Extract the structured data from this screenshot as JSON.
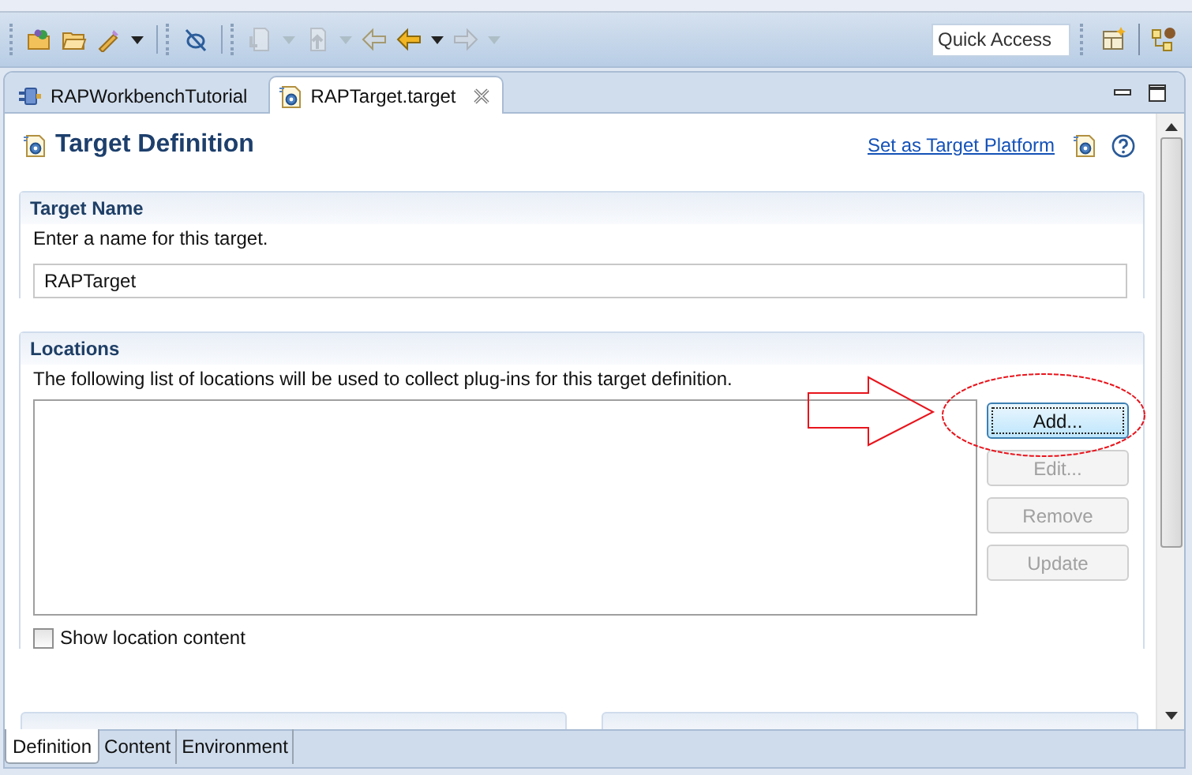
{
  "toolbar": {
    "items": [
      {
        "kind": "folder-plug",
        "disabled": false,
        "dropdown": false
      },
      {
        "kind": "folder",
        "disabled": false,
        "dropdown": false
      },
      {
        "kind": "wand",
        "disabled": false,
        "dropdown": true
      },
      {
        "kind": "separator"
      },
      {
        "kind": "link-off",
        "disabled": false,
        "dropdown": false
      },
      {
        "kind": "separator"
      },
      {
        "kind": "doc-down",
        "disabled": true,
        "dropdown": true
      },
      {
        "kind": "doc-up",
        "disabled": true,
        "dropdown": true
      },
      {
        "kind": "arrow-left",
        "disabled": true,
        "dropdown": false
      },
      {
        "kind": "arrow-left",
        "disabled": false,
        "dropdown": true
      },
      {
        "kind": "arrow-right",
        "disabled": true,
        "dropdown": true
      }
    ],
    "quick_access": {
      "placeholder": "Quick Access"
    }
  },
  "editor_tabs": [
    {
      "label": "RAPWorkbenchTutorial",
      "selected": false,
      "kind": "plugin"
    },
    {
      "label": "RAPTarget.target",
      "selected": true,
      "kind": "target"
    }
  ],
  "page": {
    "title": "Target Definition",
    "link": "Set as Target Platform"
  },
  "sections": [
    {
      "kind": "name",
      "title": "Target Name",
      "description": "Enter a name for this target.",
      "value": "RAPTarget"
    },
    {
      "kind": "locations",
      "title": "Locations",
      "description": "The following list of locations will be used to collect plug-ins for this target definition.",
      "buttons": [
        {
          "label": "Add...",
          "disabled": false,
          "focused": true
        },
        {
          "label": "Edit...",
          "disabled": true,
          "focused": false
        },
        {
          "label": "Remove",
          "disabled": true,
          "focused": false
        },
        {
          "label": "Update",
          "disabled": true,
          "focused": false
        }
      ],
      "checkbox": {
        "label": "Show location content",
        "checked": false
      }
    }
  ],
  "bottom_tabs": [
    {
      "label": "Definition",
      "selected": true
    },
    {
      "label": "Content",
      "selected": false
    },
    {
      "label": "Environment",
      "selected": false
    }
  ]
}
